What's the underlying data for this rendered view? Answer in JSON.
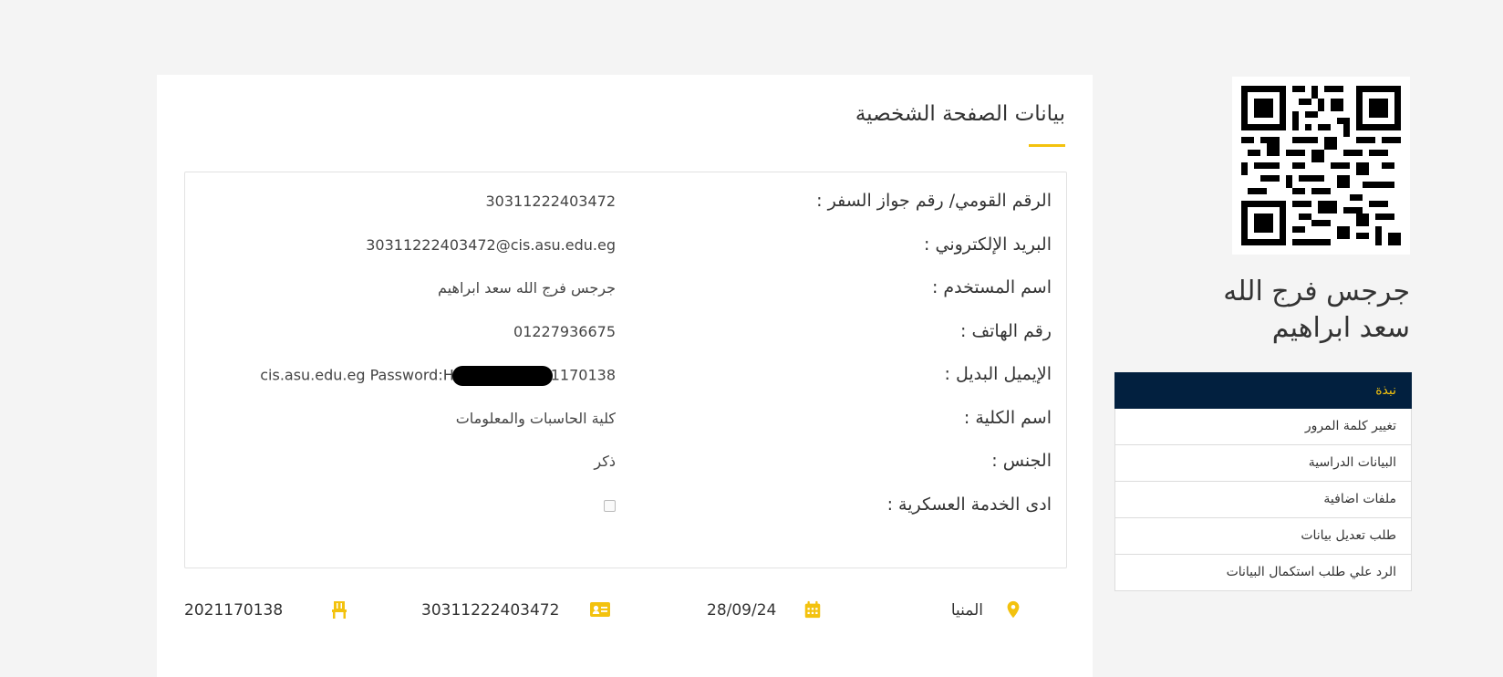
{
  "profile": {
    "title": "بيانات الصفحة الشخصية",
    "fields": [
      {
        "label": "الرقم القومي/ رقم جواز السفر :",
        "value": "30311222403472"
      },
      {
        "label": "البريد الإلكتروني :",
        "value": "30311222403472@cis.asu.edu.eg"
      },
      {
        "label": "اسم المستخدم :",
        "value": "جرجس فرج الله سعد ابراهيم"
      },
      {
        "label": "رقم الهاتف :",
        "value": "01227936675"
      },
      {
        "label": "الإيميل البديل :",
        "value_prefix": "cis.asu.edu.eg Password:H",
        "value_suffix": "1170138"
      },
      {
        "label": "اسم الكلية :",
        "value": "كلية الحاسبات والمعلومات"
      },
      {
        "label": "الجنس :",
        "value": "ذكر"
      },
      {
        "label": "ادى الخدمة العسكرية :",
        "checked": false
      }
    ]
  },
  "stats": {
    "location": "المنيا",
    "date": "28/09/24",
    "national_id": "30311222403472",
    "student_code": "2021170138"
  },
  "icons": {
    "location": "map-pin-icon",
    "date": "calendar-icon",
    "id_card": "id-card-icon",
    "seat": "chair-icon",
    "qr": "qr-code"
  },
  "sidebar": {
    "user_name": "جرجس فرج الله سعد ابراهيم",
    "menu": [
      {
        "label": "نبذة",
        "active": true
      },
      {
        "label": "تغيير كلمة المرور"
      },
      {
        "label": "البيانات الدراسية"
      },
      {
        "label": "ملفات اضافية"
      },
      {
        "label": "طلب تعديل بيانات"
      },
      {
        "label": "الرد علي طلب استكمال البيانات"
      }
    ]
  },
  "colors": {
    "accent": "#f3c20e",
    "nav_active_bg": "#02203f",
    "background": "#f4f4f4"
  }
}
